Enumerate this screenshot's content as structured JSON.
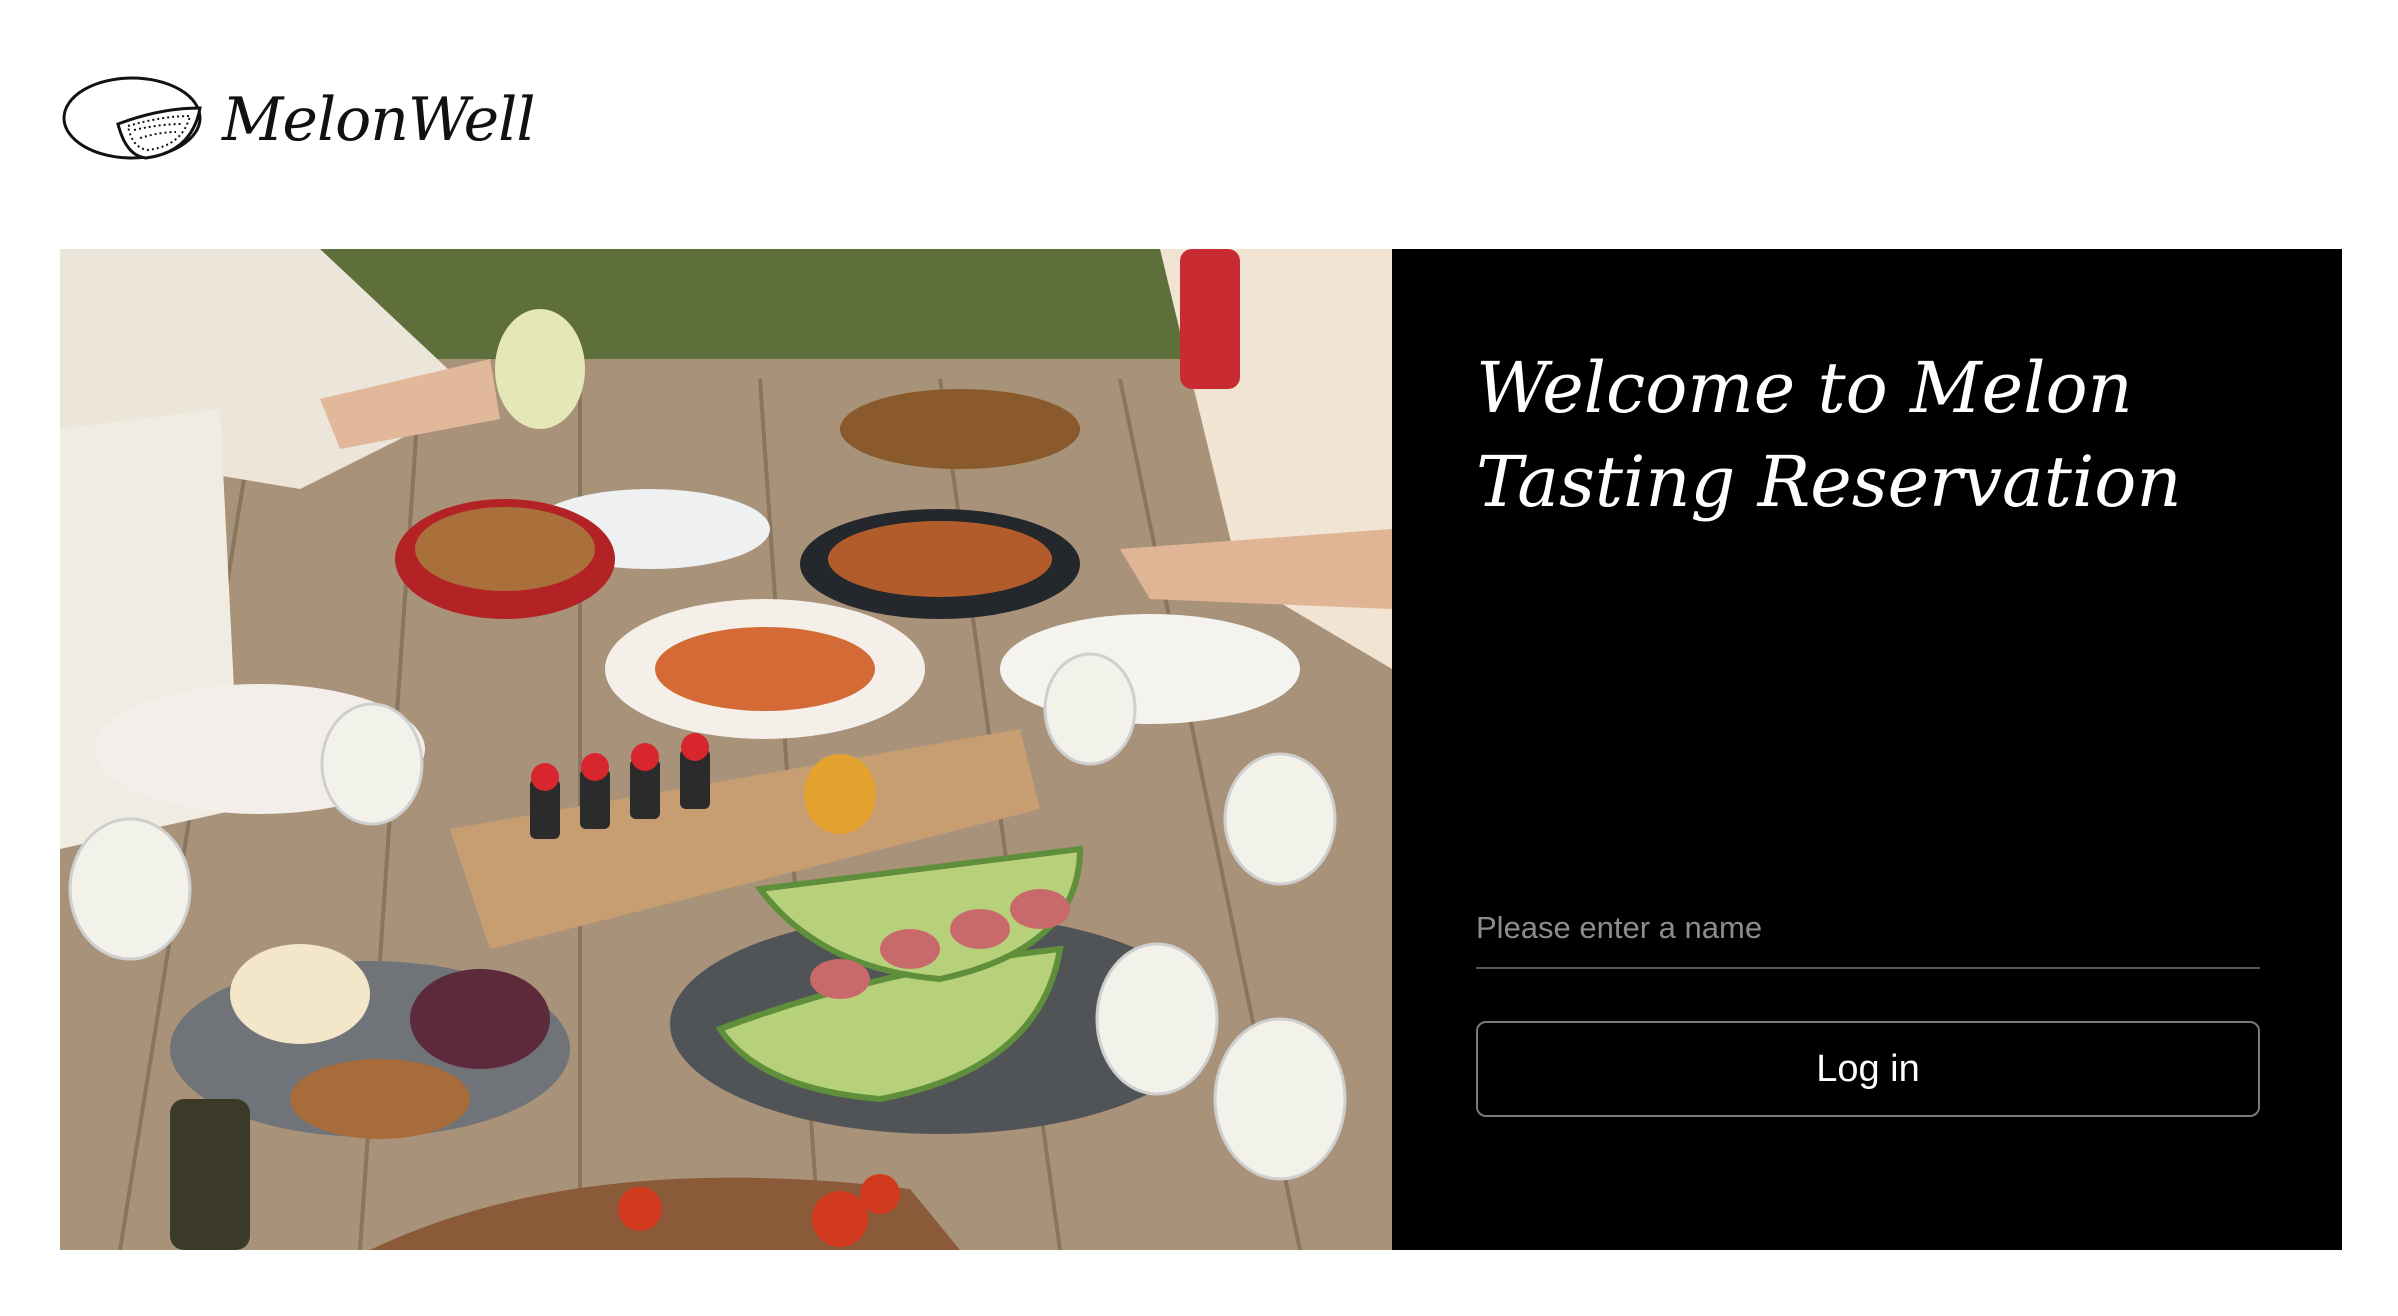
{
  "brand": {
    "name": "MelonWell",
    "logo_icon": "melon-slice-icon"
  },
  "hero": {
    "image_icon": "picnic-table-photo"
  },
  "login": {
    "title": "Welcome to Melon Tasting Reservation",
    "name_placeholder": "Please enter a name",
    "name_value": "",
    "login_label": "Log in"
  },
  "colors": {
    "panel_background": "#000000",
    "page_background": "#ffffff",
    "text_on_panel": "#ffffff"
  }
}
